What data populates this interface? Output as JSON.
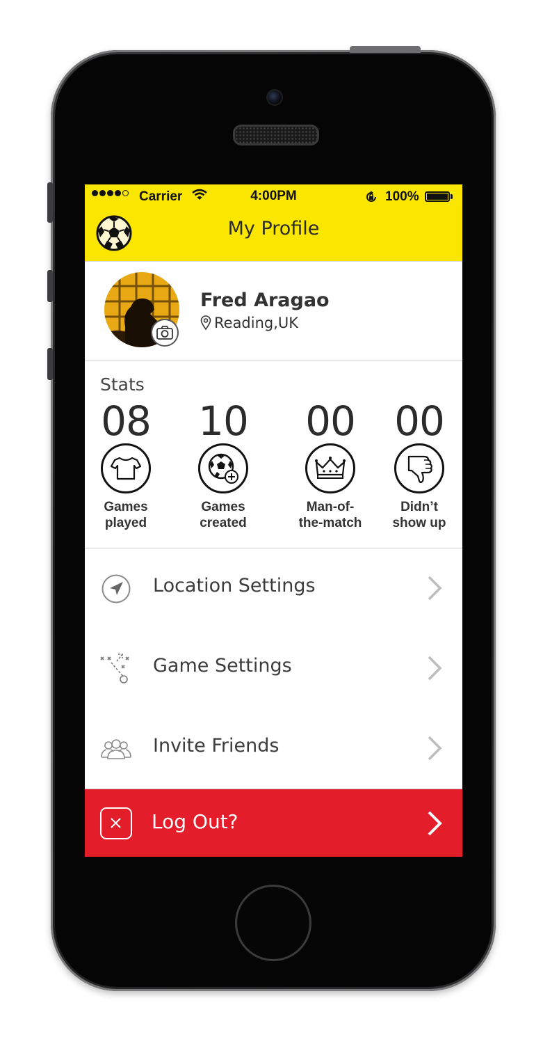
{
  "status_bar": {
    "carrier": "Carrier",
    "time": "4:00PM",
    "battery": "100%"
  },
  "nav": {
    "title": "My Profile",
    "logo_icon": "soccer-ball-icon"
  },
  "profile": {
    "name": "Fred Aragao",
    "location": "Reading,UK"
  },
  "stats": {
    "title": "Stats",
    "items": [
      {
        "value": "08",
        "line1": "Games",
        "line2": "played",
        "icon": "tshirt-icon"
      },
      {
        "value": "10",
        "line1": "Games",
        "line2": "created",
        "icon": "ball-plus-icon"
      },
      {
        "value": "00",
        "line1": "Man-of-",
        "line2": "the-match",
        "icon": "crown-icon"
      },
      {
        "value": "00",
        "line1": "Didn’t",
        "line2": "show up",
        "icon": "thumbs-down-icon"
      }
    ]
  },
  "menu": {
    "location_settings": "Location Settings",
    "game_settings": "Game Settings",
    "invite_friends": "Invite Friends",
    "logout": "Log Out?"
  },
  "colors": {
    "accent_yellow": "#fbe600",
    "logout_red": "#e31d2a"
  }
}
